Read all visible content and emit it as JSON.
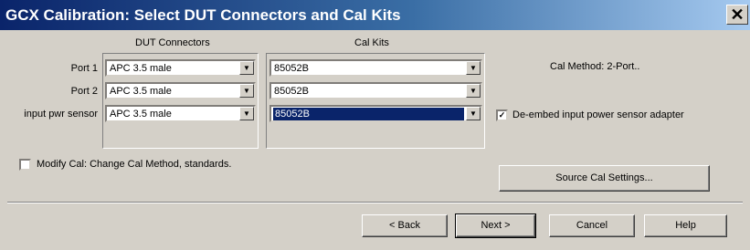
{
  "window": {
    "title": "GCX Calibration: Select DUT Connectors and Cal Kits",
    "close_glyph": "✕"
  },
  "dut_connectors": {
    "heading": "DUT Connectors",
    "rows": [
      {
        "label": "Port 1",
        "value": "APC 3.5 male"
      },
      {
        "label": "Port 2",
        "value": "APC 3.5 male"
      },
      {
        "label": "input pwr sensor",
        "value": "APC 3.5 male"
      }
    ]
  },
  "cal_kits": {
    "heading": "Cal Kits",
    "rows": [
      {
        "value": "85052B"
      },
      {
        "value": "85052B"
      },
      {
        "value": "85052B",
        "selected": true
      }
    ]
  },
  "cal_method": {
    "text": "Cal Method:  2-Port.."
  },
  "deembed": {
    "checked": true,
    "label": "De-embed input power sensor adapter"
  },
  "modify_cal": {
    "checked": false,
    "label": "Modify Cal: Change Cal Method, standards."
  },
  "buttons": {
    "source_cal": "Source Cal Settings...",
    "back": "< Back",
    "next": "Next >",
    "cancel": "Cancel",
    "help": "Help"
  },
  "icons": {
    "dropdown": "chevron-down-icon",
    "check": "checkmark-icon"
  },
  "colors": {
    "titlebar_start": "#0a246a",
    "titlebar_end": "#a6caf0",
    "dialog_bg": "#d4d0c8",
    "selection": "#0a246a"
  }
}
